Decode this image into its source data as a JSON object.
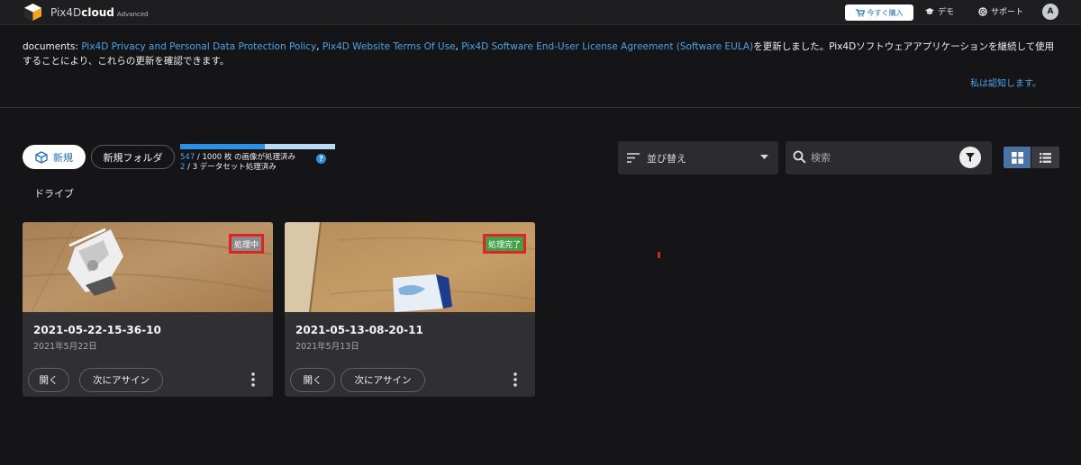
{
  "app": {
    "brand": "Pix4D",
    "brand_bold": "cloud",
    "edition": "Advanced"
  },
  "topbar": {
    "buy_label": "今すぐ購入",
    "demo_label": "デモ",
    "support_label": "サポート",
    "avatar_initial": "A"
  },
  "notice": {
    "prefix": "documents: ",
    "link1": "Pix4D Privacy and Personal Data Protection Policy",
    "sep1": ", ",
    "link2": "Pix4D Website Terms Of Use",
    "sep2": ", ",
    "link3": "Pix4D Software End-User License Agreement (Software EULA)",
    "suffix": "を更新しました。Pix4Dソフトウェアアプリケーションを継続して使用することにより、これらの更新を確認できます。",
    "ack_label": "私は認知します。"
  },
  "toolbar": {
    "new_label": "新規",
    "new_folder_label": "新規フォルダ",
    "images_processed": "547",
    "images_total_text": " / 1000 枚 の画像が処理済み",
    "images_fraction": 0.547,
    "datasets_processed": "2",
    "datasets_total_text": " / 3 データセット処理済み",
    "help_label": "?",
    "sort_label": "並び替え",
    "search_placeholder": "検索"
  },
  "breadcrumb": "ドライブ",
  "datasets": [
    {
      "title": "2021-05-22-15-36-10",
      "date": "2021年5月22日",
      "status": "処理中",
      "status_color": "#8a8a8a",
      "open_label": "開く",
      "assign_label": "次にアサイン"
    },
    {
      "title": "2021-05-13-08-20-11",
      "date": "2021年5月13日",
      "status": "処理完了",
      "status_color": "#43a047",
      "open_label": "開く",
      "assign_label": "次にアサイン"
    }
  ],
  "colors": {
    "accent": "#2f8fe0",
    "link": "#4aa3ec",
    "background": "#151517",
    "card": "#303033",
    "badge_border": "#e02424"
  }
}
